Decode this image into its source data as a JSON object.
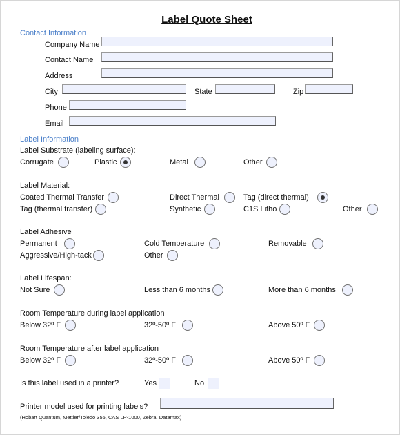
{
  "title": "Label Quote Sheet",
  "contact": {
    "section": "Contact Information",
    "company_label": "Company Name",
    "company_value": "",
    "contact_label": "Contact Name",
    "contact_value": "",
    "address_label": "Address",
    "address_value": "",
    "city_label": "City",
    "city_value": "",
    "state_label": "State",
    "state_value": "",
    "zip_label": "Zip",
    "zip_value": "",
    "phone_label": "Phone",
    "phone_value": "",
    "email_label": "Email",
    "email_value": ""
  },
  "label_info": {
    "section": "Label Information",
    "substrate": {
      "question": "Label Substrate (labeling surface):",
      "options": [
        "Corrugate",
        "Plastic",
        "Metal",
        "Other"
      ],
      "selected": "Plastic"
    },
    "material": {
      "question": "Label Material:",
      "options": [
        "Coated Thermal Transfer",
        "Direct Thermal",
        "Tag (direct thermal)",
        "Tag (thermal transfer)",
        "Synthetic",
        "C1S Litho",
        "Other"
      ],
      "selected": "Tag (direct thermal)"
    },
    "adhesive": {
      "question": "Label Adhesive",
      "options": [
        "Permanent",
        "Cold Temperature",
        "Removable",
        "Aggressive/High-tack",
        "Other"
      ],
      "selected": null
    },
    "lifespan": {
      "question": "Label Lifespan:",
      "options": [
        "Not Sure",
        "Less than 6 months",
        "More than 6 months"
      ],
      "selected": null
    },
    "temp_during": {
      "question": "Room Temperature during label application",
      "options": [
        "Below 32º F",
        "32º-50º F",
        "Above 50º F"
      ],
      "selected": null
    },
    "temp_after": {
      "question": "Room Temperature after label application",
      "options": [
        "Below 32º F",
        "32º-50º F",
        "Above 50º F"
      ],
      "selected": null
    },
    "printer": {
      "question": "Is this label used in a printer?",
      "yes_label": "Yes",
      "no_label": "No",
      "yes_checked": false,
      "no_checked": false
    },
    "printer_model": {
      "question": "Printer model used for printing labels?",
      "value": "",
      "hint": "(Hobart Quantum, Mettler/Toledo 355, CAS LP-1000, Zebra, Datamax)"
    }
  }
}
